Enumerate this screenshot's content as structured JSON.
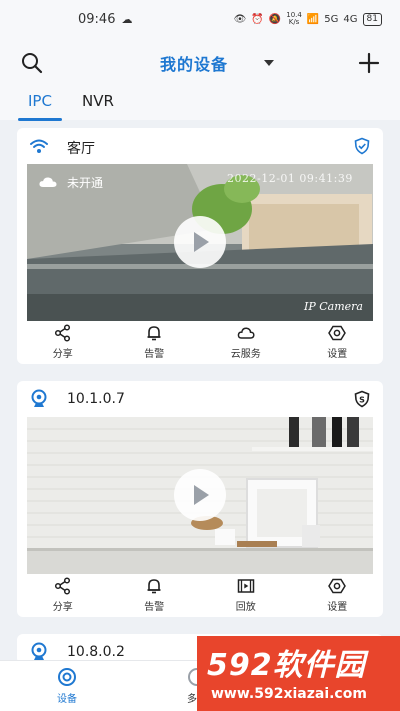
{
  "status_bar": {
    "time": "09:46",
    "net_speed_top": "10.4",
    "net_speed_bottom": "K/s",
    "signal": "5G",
    "signal2": "4G",
    "battery": "81"
  },
  "header": {
    "title": "我的设备",
    "search_icon": "search-icon",
    "add_icon": "plus-icon"
  },
  "tabs": [
    {
      "label": "IPC",
      "active": true
    },
    {
      "label": "NVR",
      "active": false
    }
  ],
  "devices": [
    {
      "name": "客厅",
      "icon": "wifi-icon",
      "badge_icon": "shield-check-icon",
      "cloud_status": "未开通",
      "timestamp": "2022-12-01 09:41:39",
      "camera_label": "IP Camera",
      "actions": [
        {
          "label": "分享",
          "icon": "share-icon"
        },
        {
          "label": "告警",
          "icon": "bell-icon"
        },
        {
          "label": "云服务",
          "icon": "cloud-icon"
        },
        {
          "label": "设置",
          "icon": "settings-icon"
        }
      ]
    },
    {
      "name": "10.1.0.7",
      "icon": "webcam-icon",
      "badge_icon": "s-shield-icon",
      "actions": [
        {
          "label": "分享",
          "icon": "share-icon"
        },
        {
          "label": "告警",
          "icon": "bell-icon"
        },
        {
          "label": "回放",
          "icon": "playback-icon"
        },
        {
          "label": "设置",
          "icon": "settings-icon"
        }
      ]
    },
    {
      "name": "10.8.0.2",
      "icon": "webcam-icon"
    }
  ],
  "bottom_nav": [
    {
      "label": "设备",
      "active": true,
      "icon": "device-icon"
    },
    {
      "label": "多媒",
      "active": false,
      "icon": "media-icon"
    }
  ],
  "watermark": {
    "brand": "592软件园",
    "url": "www.592xiazai.com"
  },
  "colors": {
    "accent": "#1f78d1",
    "watermark": "#e8452c"
  }
}
